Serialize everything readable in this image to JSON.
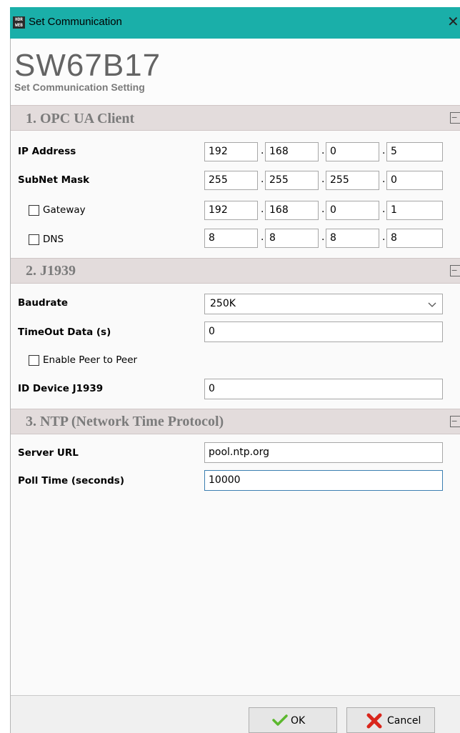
{
  "window": {
    "title": "Set Communication",
    "app_icon_text": "HDR WEB",
    "close_glyph": "✕"
  },
  "header": {
    "title": "SW67B17",
    "subtitle": "Set Communication Setting"
  },
  "sections": {
    "opc": {
      "title": "1. OPC UA Client",
      "collapse_glyph": "−",
      "ip_address": {
        "label": "IP Address",
        "octets": [
          "192",
          "168",
          "0",
          "5"
        ]
      },
      "subnet_mask": {
        "label": "SubNet Mask",
        "octets": [
          "255",
          "255",
          "255",
          "0"
        ]
      },
      "gateway": {
        "label": "Gateway",
        "checked": false,
        "octets": [
          "192",
          "168",
          "0",
          "1"
        ]
      },
      "dns": {
        "label": "DNS",
        "checked": false,
        "octets": [
          "8",
          "8",
          "8",
          "8"
        ]
      }
    },
    "j1939": {
      "title": "2. J1939",
      "collapse_glyph": "−",
      "baudrate": {
        "label": "Baudrate",
        "value": "250K"
      },
      "timeout": {
        "label": "TimeOut Data (s)",
        "value": "0"
      },
      "peer": {
        "label": "Enable Peer to Peer",
        "checked": false
      },
      "device_id": {
        "label": "ID Device J1939",
        "value": "0"
      }
    },
    "ntp": {
      "title": "3. NTP (Network Time Protocol)",
      "collapse_glyph": "−",
      "server_url": {
        "label": "Server URL",
        "value": "pool.ntp.org"
      },
      "poll_time": {
        "label": "Poll Time (seconds)",
        "value": "10000"
      }
    }
  },
  "buttons": {
    "ok": "OK",
    "cancel": "Cancel"
  },
  "icons": {
    "ok": "checkmark-icon",
    "cancel": "x-mark-icon",
    "chevron": "chevron-down-icon"
  },
  "colors": {
    "titlebar": "#1aafa9",
    "section_bar": "#e3dcdc",
    "ok_green": "#5cb82e",
    "cancel_red": "#d9261c"
  }
}
